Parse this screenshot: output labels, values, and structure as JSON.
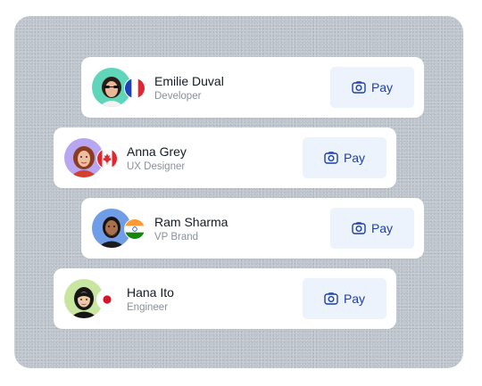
{
  "people": [
    {
      "name": "Emilie Duval",
      "role": "Developer",
      "pay_label": "Pay",
      "flag": "france-flag",
      "avatar_bg": "#5fd6b9"
    },
    {
      "name": "Anna Grey",
      "role": "UX Designer",
      "pay_label": "Pay",
      "flag": "canada-flag",
      "avatar_bg": "#b8a6f2"
    },
    {
      "name": "Ram Sharma",
      "role": "VP Brand",
      "pay_label": "Pay",
      "flag": "india-flag",
      "avatar_bg": "#6f9de8"
    },
    {
      "name": "Hana Ito",
      "role": "Engineer",
      "pay_label": "Pay",
      "flag": "japan-flag",
      "avatar_bg": "#c9e6a0"
    }
  ],
  "icons": {
    "pay": "camera-icon"
  },
  "colors": {
    "accent": "#1d3fa8",
    "button_bg": "#edf3fc",
    "panel_bg": "#c2c8d0"
  }
}
